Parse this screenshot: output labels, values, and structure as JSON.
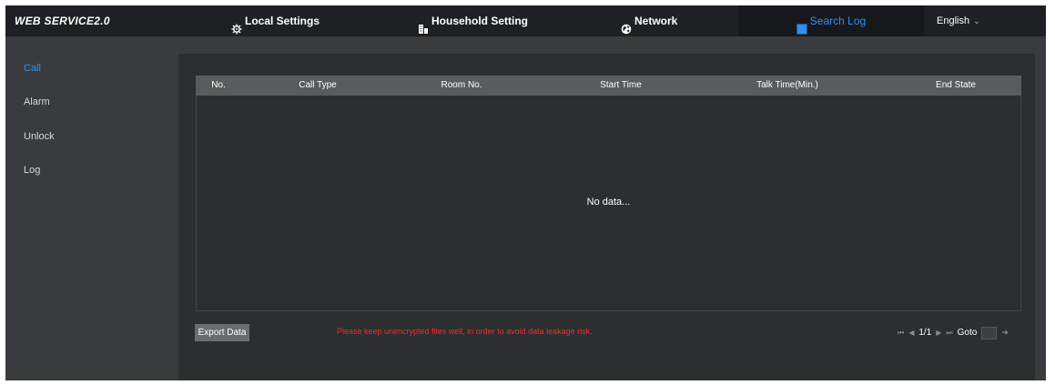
{
  "app": {
    "logo": "WEB SERVICE2.0"
  },
  "nav": {
    "items": [
      {
        "label": "Local Settings",
        "icon": "gear-icon"
      },
      {
        "label": "Household Setting",
        "icon": "building-icon"
      },
      {
        "label": "Network",
        "icon": "globe-icon"
      },
      {
        "label": "Search Log",
        "icon": "search-log-icon",
        "active": true
      }
    ],
    "language": "English"
  },
  "sidebar": {
    "items": [
      {
        "label": "Call",
        "active": true
      },
      {
        "label": "Alarm"
      },
      {
        "label": "Unlock"
      },
      {
        "label": "Log"
      }
    ]
  },
  "table": {
    "columns": [
      "No.",
      "Call Type",
      "Room No.",
      "Start Time",
      "Talk Time(Min.)",
      "End State"
    ],
    "empty_text": "No data..."
  },
  "footer": {
    "export_label": "Export Data",
    "warning": "Please keep unencrypted files well, in order to avoid data leakage risk.",
    "pager": {
      "page_info": "1/1",
      "goto_label": "Goto",
      "goto_value": ""
    }
  },
  "colors": {
    "accent": "#2f8ef0",
    "warning": "#e8322a",
    "topbar": "#1f2023",
    "panel": "#2d2e32"
  }
}
